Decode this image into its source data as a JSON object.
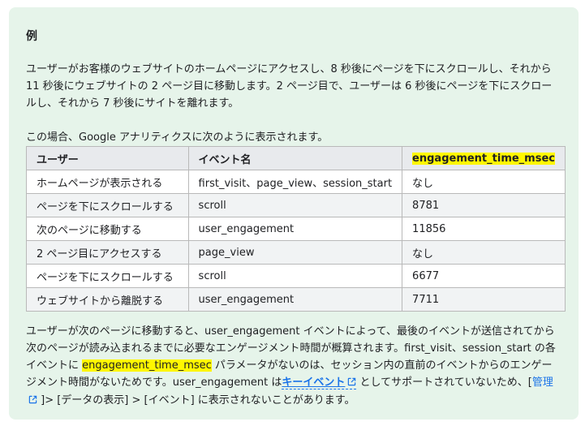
{
  "heading": "例",
  "para1": "ユーザーがお客様のウェブサイトのホームページにアクセスし、8 秒後にページを下にスクロールし、それから 11 秒後にウェブサイトの 2 ページ目に移動します。2 ページ目で、ユーザーは 6 秒後にページを下にスクロールし、それから 7 秒後にサイトを離れます。",
  "para2": "この場合、Google アナリティクスに次のように表示されます。",
  "table": {
    "headers": [
      "ユーザー",
      "イベント名",
      "engagement_time_msec"
    ],
    "rows": [
      [
        "ホームページが表示される",
        "first_visit、page_view、session_start",
        "なし"
      ],
      [
        "ページを下にスクロールする",
        "scroll",
        "8781"
      ],
      [
        "次のページに移動する",
        "user_engagement",
        "11856"
      ],
      [
        "2 ページ目にアクセスする",
        "page_view",
        "なし"
      ],
      [
        "ページを下にスクロールする",
        "scroll",
        "6677"
      ],
      [
        "ウェブサイトから離脱する",
        "user_engagement",
        "7711"
      ]
    ]
  },
  "para3": {
    "part1": "ユーザーが次のページに移動すると、user_engagement イベントによって、最後のイベントが送信されてから次のページが読み込まれるまでに必要なエンゲージメント時間が概算されます。first_visit、session_start の各イベントに ",
    "highlight": "engagement_time_msec",
    "part2": " パラメータがないのは、セッション内の直前のイベントからのエンゲージメント時間がないためです。user_engagement は",
    "link_key_event": "キーイベント",
    "part3": " としてサポートされていないため、[",
    "link_admin": "管理",
    "part4": " ]> [データの表示] > [イベント] に表示されないことがあります。"
  },
  "colors": {
    "callout_bg": "#e6f4ea",
    "highlight": "#fff700",
    "link": "#1a73e8",
    "header_bg": "#e8eaed",
    "alt_row_bg": "#f1f3f4"
  },
  "icons": [
    "external-link-icon"
  ]
}
